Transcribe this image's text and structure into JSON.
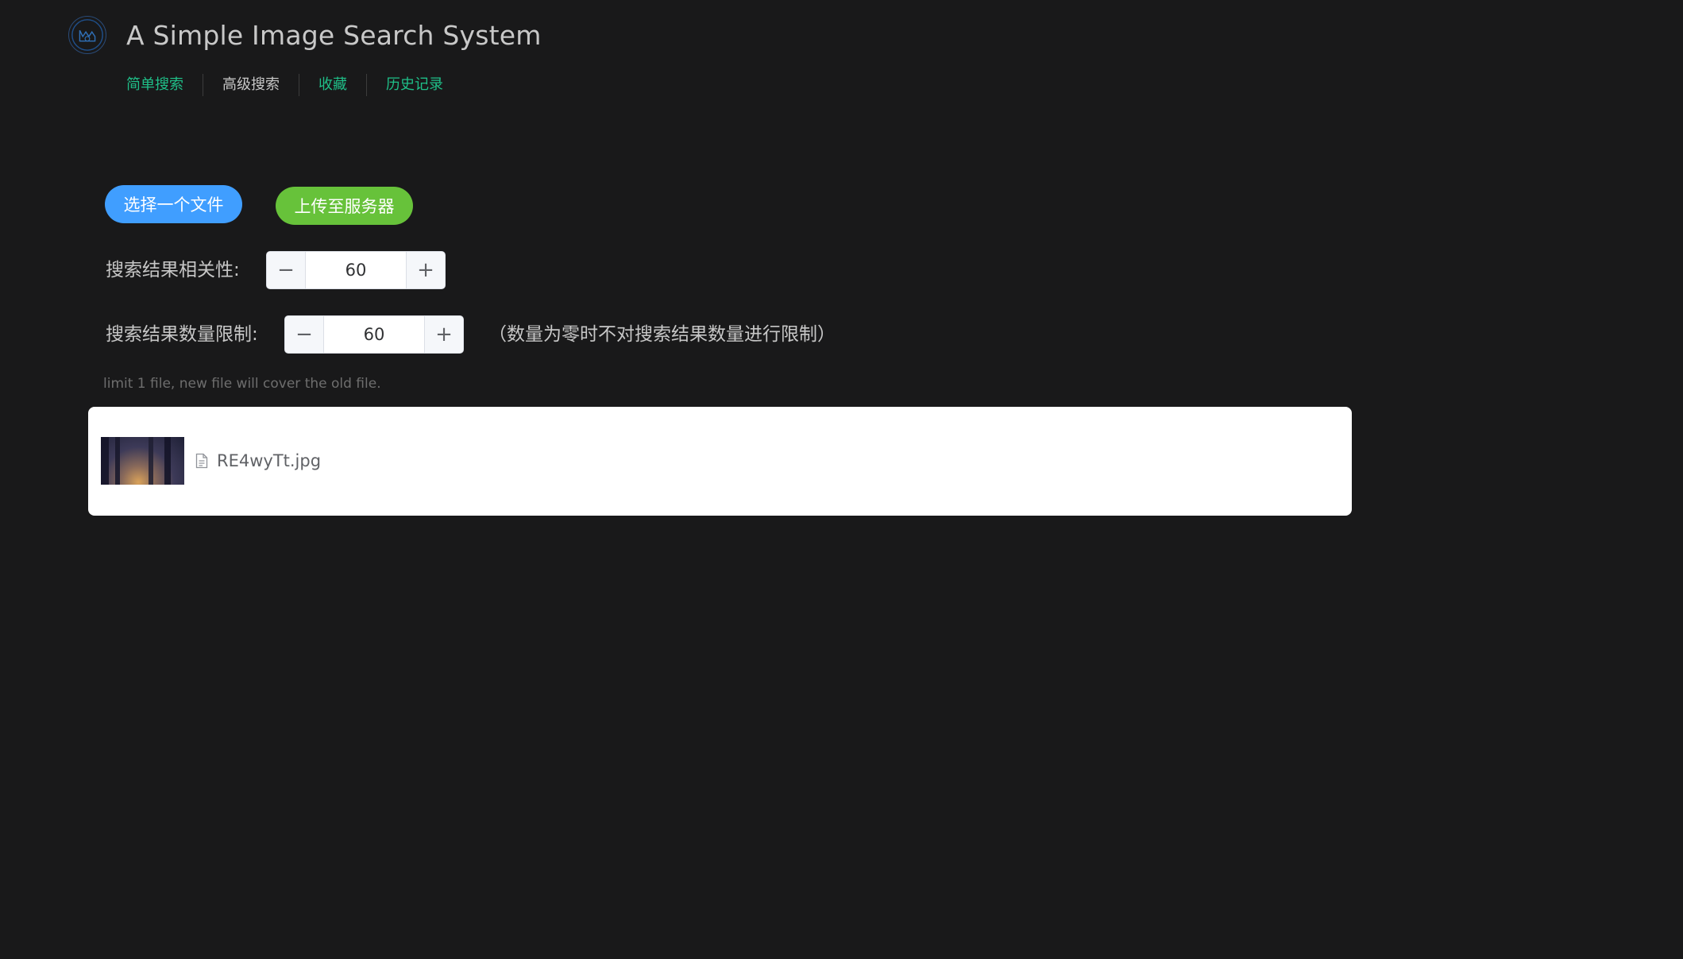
{
  "header": {
    "title": "A Simple Image Search System",
    "logo_icon": "logo-icon"
  },
  "nav": {
    "items": [
      {
        "label": "简单搜索",
        "active": false
      },
      {
        "label": "高级搜索",
        "active": true
      },
      {
        "label": "收藏",
        "active": false
      },
      {
        "label": "历史记录",
        "active": false
      }
    ]
  },
  "upload": {
    "select_label": "选择一个文件",
    "upload_label": "上传至服务器",
    "tip": "limit 1 file, new file will cover the old file."
  },
  "form": {
    "relevance_label": "搜索结果相关性:",
    "relevance_value": "60",
    "limit_label": "搜索结果数量限制:",
    "limit_value": "60",
    "limit_note": "（数量为零时不对搜索结果数量进行限制）"
  },
  "files": [
    {
      "name": "RE4wyTt.jpg",
      "icon": "document-icon"
    }
  ],
  "colors": {
    "background": "#19191a",
    "nav_link": "#1fbf88",
    "primary": "#409eff",
    "success": "#67c23a"
  }
}
